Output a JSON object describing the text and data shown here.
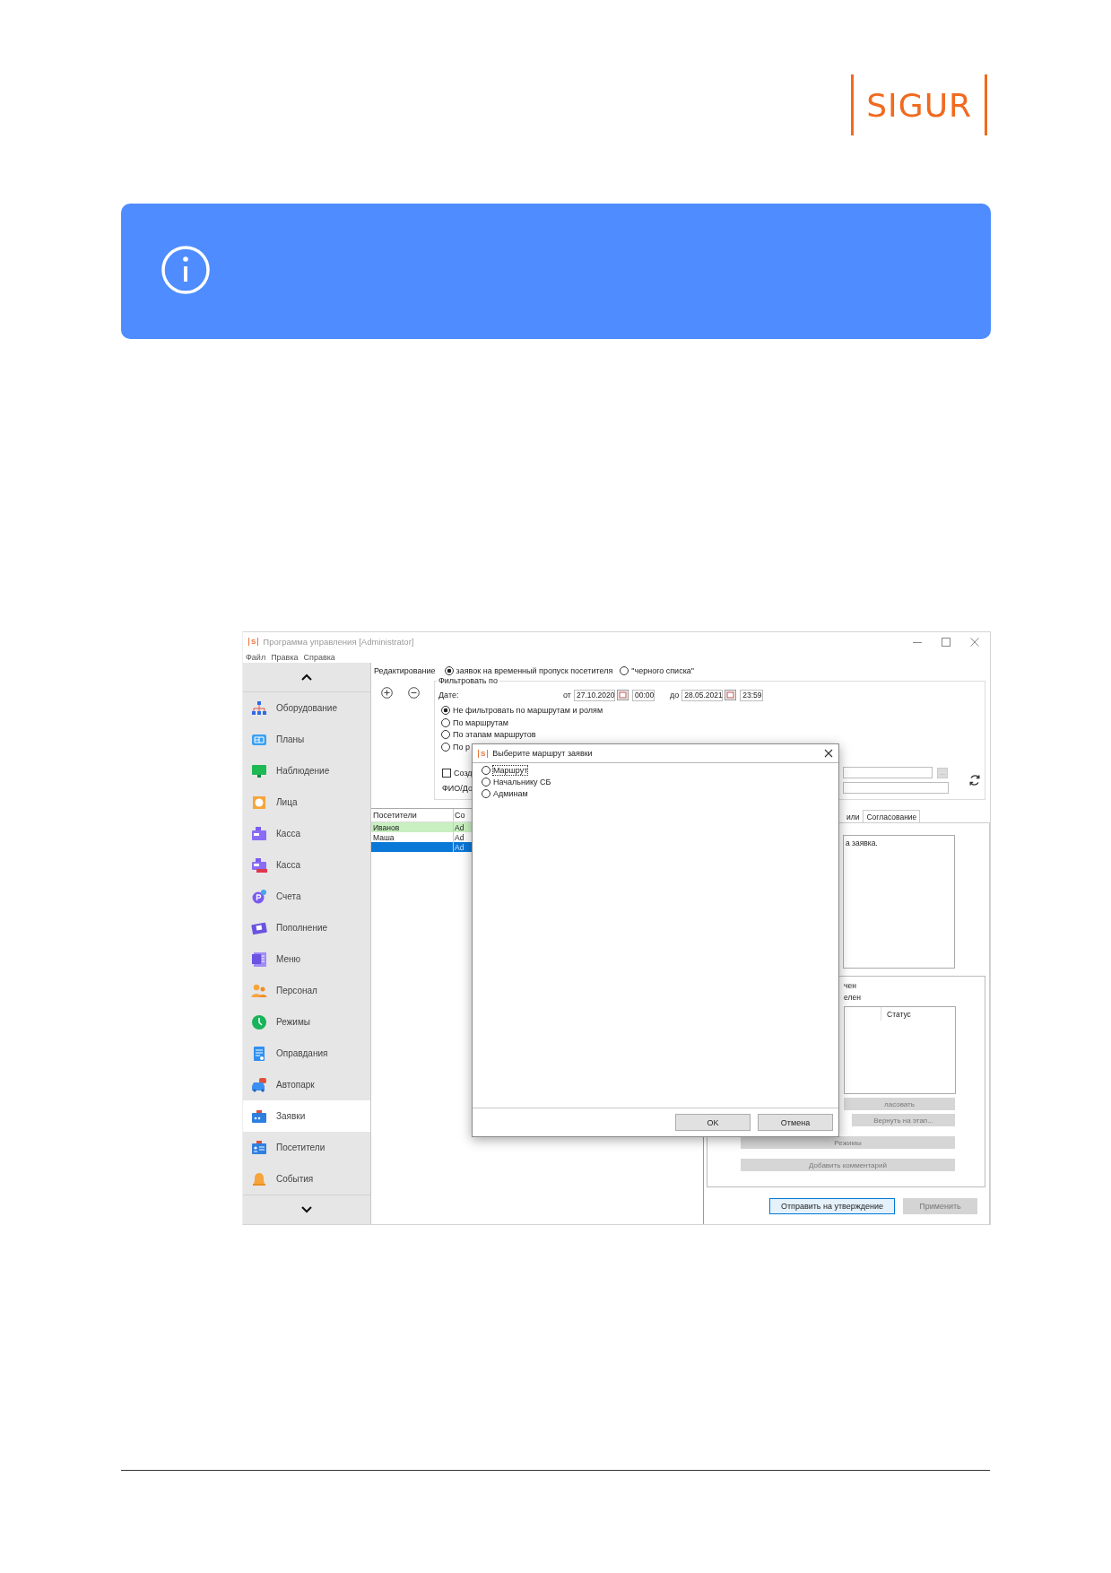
{
  "logo": {
    "text": "SIGUR"
  },
  "window": {
    "app_mark": "S",
    "title": "Программа управления [Administrator]",
    "menu": [
      "Файл",
      "Правка",
      "Справка"
    ]
  },
  "sidebar": {
    "items": [
      {
        "label": "Оборудование",
        "selected": false
      },
      {
        "label": "Планы",
        "selected": false
      },
      {
        "label": "Наблюдение",
        "selected": false
      },
      {
        "label": "Лица",
        "selected": false
      },
      {
        "label": "Касса",
        "selected": false
      },
      {
        "label": "Касса",
        "selected": false
      },
      {
        "label": "Счета",
        "selected": false
      },
      {
        "label": "Пополнение",
        "selected": false
      },
      {
        "label": "Меню",
        "selected": false
      },
      {
        "label": "Персонал",
        "selected": false
      },
      {
        "label": "Режимы",
        "selected": false
      },
      {
        "label": "Оправдания",
        "selected": false
      },
      {
        "label": "Автопарк",
        "selected": false
      },
      {
        "label": "Заявки",
        "selected": true
      },
      {
        "label": "Посетители",
        "selected": false
      },
      {
        "label": "События",
        "selected": false
      }
    ]
  },
  "editing": {
    "label": "Редактирование",
    "options": [
      {
        "label": "заявок на временный пропуск посетителя",
        "selected": true
      },
      {
        "label": "\"черного списка\"",
        "selected": false
      }
    ]
  },
  "filter": {
    "title": "Фильтровать по",
    "date_label": "Дате:",
    "from_label": "от",
    "from_date": "27.10.2020",
    "from_time": "00:00",
    "to_label": "до",
    "to_date": "28.05.2021",
    "to_time": "23:59",
    "options": [
      {
        "label": "Не фильтровать по маршрутам и ролям",
        "selected": true
      },
      {
        "label": "По маршрутам",
        "selected": false
      },
      {
        "label": "По этапам маршрутов",
        "selected": false
      },
      {
        "label": "По р",
        "selected": false
      }
    ],
    "create_checkbox": {
      "label": "Созд",
      "checked": false
    },
    "name_label": "ФИО/До",
    "browse_button": "..."
  },
  "visitors_table": {
    "columns": [
      "Посетители",
      "Со"
    ],
    "rows": [
      {
        "name": "Иванов",
        "column_2": "Ad",
        "highlighted": true,
        "selected": false
      },
      {
        "name": "Маша",
        "column_2": "Ad",
        "highlighted": false,
        "selected": false
      },
      {
        "column_2": "Ad",
        "highlighted": false,
        "selected": true
      }
    ]
  },
  "approval_panel": {
    "tabs": [
      {
        "label": "или",
        "selected": false
      },
      {
        "label": "Согласование",
        "selected": true
      }
    ],
    "note": "а заявка.",
    "status_lines": [
      "чен",
      "елен"
    ],
    "status_column": "Статус",
    "buttons": [
      {
        "label": "ласовать",
        "disabled": true
      },
      {
        "label": "Вернуть на этап...",
        "disabled": true
      },
      {
        "label": "Режимы",
        "disabled": true
      },
      {
        "label": "Добавить комментарий",
        "disabled": true
      }
    ]
  },
  "footer_buttons": [
    {
      "label": "Отправить на утверждение",
      "disabled": false
    },
    {
      "label": "Применить",
      "disabled": true
    }
  ],
  "dialog": {
    "app_mark": "S",
    "title": "Выберите маршрут заявки",
    "options": [
      {
        "label": "Маршрут",
        "selected": false,
        "focused": true
      },
      {
        "label": "Начальнику СБ",
        "selected": false,
        "focused": false
      },
      {
        "label": "Админам",
        "selected": false,
        "focused": false
      }
    ],
    "buttons": [
      "OK",
      "Отмена"
    ]
  }
}
